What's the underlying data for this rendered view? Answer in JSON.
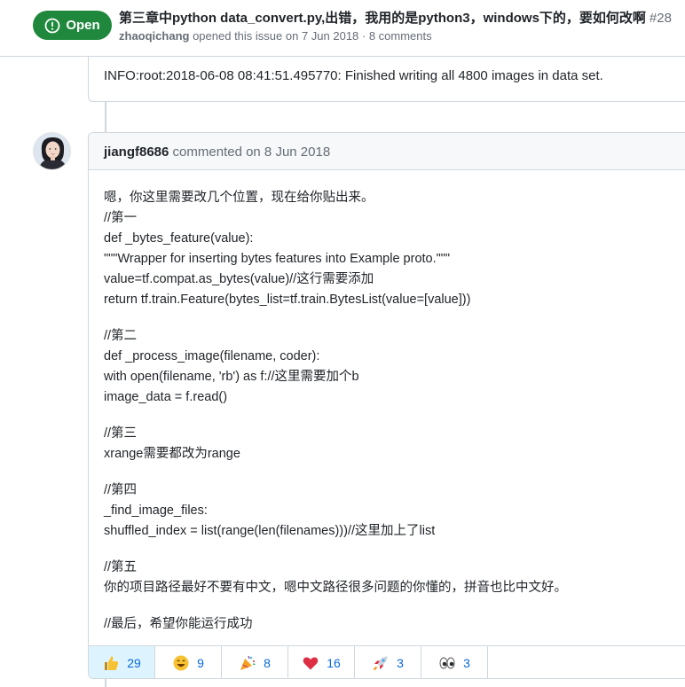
{
  "issue": {
    "state": "Open",
    "title": "第三章中python data_convert.py,出错，我用的是python3，windows下的，要如何改啊",
    "number": "#28",
    "author": "zhaoqichang",
    "meta_text": "opened this issue on 7 Jun 2018 · 8 comments"
  },
  "previous_comment": {
    "text": "INFO:root:2018-06-08 08:41:51.495770: Finished writing all 4800 images in data set."
  },
  "comment": {
    "author": "jiangf8686",
    "action": "commented on 8 Jun 2018",
    "lines": [
      "嗯，你这里需要改几个位置，现在给你贴出来。",
      "//第一",
      "def _bytes_feature(value):",
      "\"\"\"Wrapper for inserting bytes features into Example proto.\"\"\"",
      "value=tf.compat.as_bytes(value)//这行需要添加",
      "return tf.train.Feature(bytes_list=tf.train.BytesList(value=[value]))",
      "",
      "//第二",
      "def _process_image(filename, coder):",
      "with open(filename, 'rb') as f://这里需要加个b",
      "image_data = f.read()",
      "",
      "//第三",
      "xrange需要都改为range",
      "",
      "//第四",
      "_find_image_files:",
      "shuffled_index = list(range(len(filenames)))//这里加上了list",
      "",
      "//第五",
      "你的项目路径最好不要有中文，嗯中文路径很多问题的你懂的，拼音也比中文好。",
      "",
      "//最后，希望你能运行成功"
    ]
  },
  "reactions": [
    {
      "icon": "thumbs-up-icon",
      "count": "29",
      "active": true
    },
    {
      "icon": "laugh-icon",
      "count": "9",
      "active": false
    },
    {
      "icon": "hooray-icon",
      "count": "8",
      "active": false
    },
    {
      "icon": "heart-icon",
      "count": "16",
      "active": false
    },
    {
      "icon": "rocket-icon",
      "count": "3",
      "active": false
    },
    {
      "icon": "eyes-icon",
      "count": "3",
      "active": false
    }
  ],
  "colors": {
    "open_badge": "#1f883d",
    "link": "#0969da",
    "border": "#d0d7de",
    "header_bg": "#f6f8fa",
    "active_reaction_bg": "#ddf4ff"
  }
}
